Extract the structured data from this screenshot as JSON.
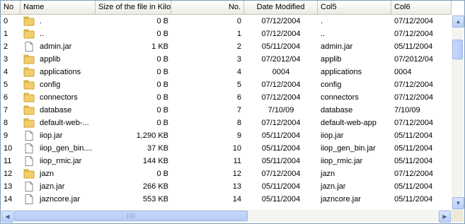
{
  "table": {
    "columns": [
      {
        "key": "no",
        "label": "No"
      },
      {
        "key": "name",
        "label": "Name"
      },
      {
        "key": "size",
        "label": "Size of the file in Kilo I"
      },
      {
        "key": "no2",
        "label": "No."
      },
      {
        "key": "date",
        "label": "Date Modified"
      },
      {
        "key": "col5",
        "label": "Col5"
      },
      {
        "key": "col6",
        "label": "Col6"
      }
    ],
    "rows": [
      {
        "no": "0",
        "icon": "folder-icon",
        "name": ".",
        "size": "0 B",
        "no2": "0",
        "date": "07/12/2004",
        "col5": ".",
        "col6": "07/12/2004"
      },
      {
        "no": "1",
        "icon": "folder-icon",
        "name": "..",
        "size": "0 B",
        "no2": "1",
        "date": "07/12/2004",
        "col5": "..",
        "col6": "07/12/2004"
      },
      {
        "no": "2",
        "icon": "file-icon",
        "name": "admin.jar",
        "size": "1 KB",
        "no2": "2",
        "date": "05/11/2004",
        "col5": "admin.jar",
        "col6": "05/11/2004"
      },
      {
        "no": "3",
        "icon": "folder-icon",
        "name": "applib",
        "size": "0 B",
        "no2": "3",
        "date": "07/2012/04",
        "col5": "applib",
        "col6": "07/2012/04"
      },
      {
        "no": "4",
        "icon": "folder-icon",
        "name": "applications",
        "size": "0 B",
        "no2": "4",
        "date": "0004",
        "col5": "applications",
        "col6": "0004"
      },
      {
        "no": "5",
        "icon": "folder-icon",
        "name": "config",
        "size": "0 B",
        "no2": "5",
        "date": "07/12/2004",
        "col5": "config",
        "col6": "07/12/2004"
      },
      {
        "no": "6",
        "icon": "folder-icon",
        "name": "connectors",
        "size": "0 B",
        "no2": "6",
        "date": "07/12/2004",
        "col5": "connectors",
        "col6": "07/12/2004"
      },
      {
        "no": "7",
        "icon": "folder-icon",
        "name": "database",
        "size": "0 B",
        "no2": "7",
        "date": "7/10/09",
        "col5": "database",
        "col6": "7/10/09"
      },
      {
        "no": "8",
        "icon": "folder-icon",
        "name": "default-web-...",
        "size": "0 B",
        "no2": "8",
        "date": "07/12/2004",
        "col5": "default-web-app",
        "col6": "07/12/2004"
      },
      {
        "no": "9",
        "icon": "file-icon",
        "name": "iiop.jar",
        "size": "1,290 KB",
        "no2": "9",
        "date": "05/11/2004",
        "col5": "iiop.jar",
        "col6": "05/11/2004"
      },
      {
        "no": "10",
        "icon": "file-icon",
        "name": "iiop_gen_bin....",
        "size": "37 KB",
        "no2": "10",
        "date": "05/11/2004",
        "col5": "iiop_gen_bin.jar",
        "col6": "05/11/2004"
      },
      {
        "no": "11",
        "icon": "file-icon",
        "name": "iiop_rmic.jar",
        "size": "144 KB",
        "no2": "11",
        "date": "05/11/2004",
        "col5": "iiop_rmic.jar",
        "col6": "05/11/2004"
      },
      {
        "no": "12",
        "icon": "folder-icon",
        "name": "jazn",
        "size": "0 B",
        "no2": "12",
        "date": "07/12/2004",
        "col5": "jazn",
        "col6": "07/12/2004"
      },
      {
        "no": "13",
        "icon": "file-icon",
        "name": "jazn.jar",
        "size": "266 KB",
        "no2": "13",
        "date": "05/11/2004",
        "col5": "jazn.jar",
        "col6": "05/11/2004"
      },
      {
        "no": "14",
        "icon": "file-icon",
        "name": "jazncore.jar",
        "size": "553 KB",
        "no2": "14",
        "date": "05/11/2004",
        "col5": "jazncore.jar",
        "col6": "05/11/2004"
      }
    ]
  },
  "scrollbars": {
    "vertical": {
      "up": "▲",
      "down": "▼",
      "position": 0.1
    },
    "horizontal": {
      "left": "◀",
      "right": "▶",
      "position": 0.0
    }
  },
  "colors": {
    "folder": "#f2cf6a",
    "folder_border": "#c9a032",
    "file_border": "#8a8a8a",
    "frame_border": "#7f9db9"
  }
}
